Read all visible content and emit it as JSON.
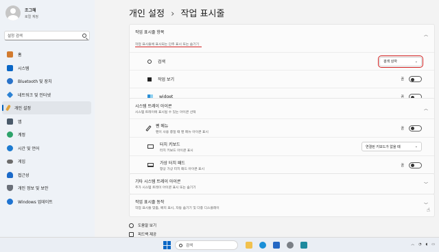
{
  "user": {
    "name": "조그해",
    "subtitle": "로컬 계정"
  },
  "search": {
    "placeholder": "설정 검색"
  },
  "sidebar": {
    "items": [
      {
        "label": "홈",
        "icon": "home-icon",
        "color": "#d27b2f"
      },
      {
        "label": "시스템",
        "icon": "system-icon",
        "color": "#0a67c6"
      },
      {
        "label": "Bluetooth 및 장치",
        "icon": "bluetooth-icon",
        "color": "#2a73c9"
      },
      {
        "label": "네트워크 및 인터넷",
        "icon": "network-icon",
        "color": "#2d82d4"
      },
      {
        "label": "개인 설정",
        "icon": "brush-icon",
        "color": "#e0a23a"
      },
      {
        "label": "앱",
        "icon": "apps-icon",
        "color": "#4a5a6a"
      },
      {
        "label": "계정",
        "icon": "account-icon",
        "color": "#2ea36b"
      },
      {
        "label": "시간 및 언어",
        "icon": "clock-icon",
        "color": "#1d7bd0"
      },
      {
        "label": "게임",
        "icon": "game-icon",
        "color": "#6c6c6c"
      },
      {
        "label": "접근성",
        "icon": "accessibility-icon",
        "color": "#1b6ac9"
      },
      {
        "label": "개인 정보 및 보안",
        "icon": "shield-icon",
        "color": "#6a6f78"
      },
      {
        "label": "Windows 업데이트",
        "icon": "update-icon",
        "color": "#1f74d1"
      }
    ]
  },
  "header": {
    "parent": "개인 설정",
    "separator": "›",
    "current": "작업 표시줄"
  },
  "taskbar_items": {
    "title": "작업 표시줄 항목",
    "subtitle": "작업 표시줄에 표시되는 단추 표시 또는 숨기기",
    "rows": [
      {
        "label": "검색",
        "control": "dropdown",
        "value": "검색 상자",
        "icon": "search-icon"
      },
      {
        "label": "작업 보기",
        "control": "toggle",
        "state": "끔",
        "icon": "task-view-icon"
      },
      {
        "label": "widget",
        "control": "toggle",
        "state": "끔",
        "icon": "widget-icon"
      }
    ]
  },
  "tray_icons": {
    "title": "시스템 트레이 아이콘",
    "subtitle": "시스템 트레이에 표시될 수 있는 아이콘 선택",
    "rows": [
      {
        "label": "펜 메뉴",
        "sub": "펜이 사용 중일 때 펜 메뉴 아이콘 표시",
        "control": "toggle",
        "state": "끔",
        "icon": "pen-icon"
      },
      {
        "label": "터치 키보드",
        "sub": "터치 키보드 아이콘 표시",
        "control": "dropdown",
        "value": "연결된 키보드가 없을 때",
        "icon": "keyboard-icon"
      },
      {
        "label": "가상 터치 패드",
        "sub": "항상 가상 터치 패드 아이콘 표시",
        "control": "toggle",
        "state": "끔",
        "icon": "touchpad-icon"
      }
    ]
  },
  "other_tray": {
    "title": "기타 시스템 트레이 아이콘",
    "subtitle": "추가 시스템 트레이 아이콘 표시 또는 숨기기"
  },
  "behaviors": {
    "title": "작업 표시줄 동작",
    "subtitle": "작업 표시줄 맞춤, 배지 표시, 자동 숨기기 및 다중 디스플레이"
  },
  "links": {
    "help": "도움말 보기",
    "feedback": "피드백 제공"
  },
  "taskbar": {
    "search_label": "검색"
  },
  "colors": {
    "accent": "#005fb8",
    "highlight": "#d21f1f"
  }
}
